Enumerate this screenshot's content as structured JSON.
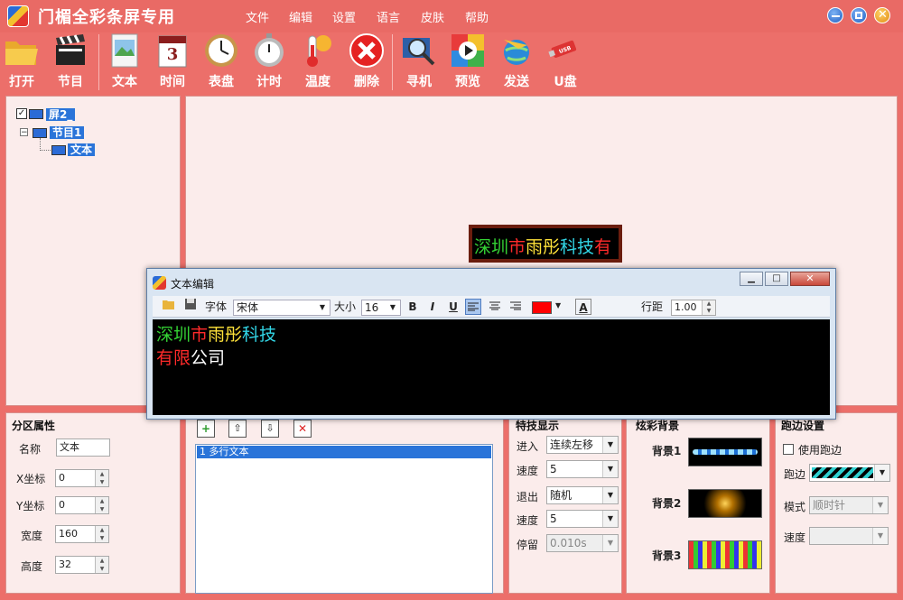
{
  "app": {
    "title": "门楣全彩条屏专用"
  },
  "menu": [
    "文件",
    "编辑",
    "设置",
    "语言",
    "皮肤",
    "帮助"
  ],
  "toolbar": [
    {
      "label": "打开",
      "icon": "folder-open-icon"
    },
    {
      "label": "节目",
      "icon": "clapperboard-icon"
    },
    {
      "label": "文本",
      "icon": "text-document-icon"
    },
    {
      "label": "时间",
      "icon": "calendar-icon"
    },
    {
      "label": "表盘",
      "icon": "clock-icon"
    },
    {
      "label": "计时",
      "icon": "stopwatch-icon"
    },
    {
      "label": "温度",
      "icon": "thermometer-icon"
    },
    {
      "label": "删除",
      "icon": "delete-icon"
    },
    {
      "label": "寻机",
      "icon": "search-monitor-icon"
    },
    {
      "label": "预览",
      "icon": "play-icon"
    },
    {
      "label": "发送",
      "icon": "send-globe-icon"
    },
    {
      "label": "U盘",
      "icon": "usb-drive-icon"
    }
  ],
  "tree": {
    "screen": "屏2_",
    "program": "节目1",
    "item": "文本"
  },
  "preview": {
    "text_segments": [
      {
        "text": "深圳",
        "color": "#34d234"
      },
      {
        "text": "市",
        "color": "#ff2a2a"
      },
      {
        "text": "雨彤",
        "color": "#ffe23a"
      },
      {
        "text": "科技",
        "color": "#32d6e6"
      },
      {
        "text": "有",
        "color": "#ff2a2a"
      }
    ]
  },
  "dialog": {
    "title": "文本编辑",
    "font_label": "字体",
    "font_value": "宋体",
    "size_label": "大小",
    "size_value": "16",
    "bold": "B",
    "italic": "I",
    "underline": "U",
    "color_value": "#ff0000",
    "line_spacing_label": "行距",
    "line_spacing_value": "1.00",
    "line1": [
      {
        "text": "深圳",
        "color": "#34d234"
      },
      {
        "text": "市",
        "color": "#ff2a2a"
      },
      {
        "text": "雨彤",
        "color": "#ffe23a"
      },
      {
        "text": "科技",
        "color": "#32d6e6"
      }
    ],
    "line2": [
      {
        "text": "有限",
        "color": "#ff2a2a"
      },
      {
        "text": "公司",
        "color": "#ffffff"
      }
    ]
  },
  "region": {
    "title": "分区属性",
    "name_label": "名称",
    "name_value": "文本",
    "x_label": "X坐标",
    "x_value": "0",
    "y_label": "Y坐标",
    "y_value": "0",
    "width_label": "宽度",
    "width_value": "160",
    "height_label": "高度",
    "height_value": "32"
  },
  "list": {
    "items": [
      "1 多行文本"
    ]
  },
  "effects": {
    "title": "特技显示",
    "enter_label": "进入",
    "enter_value": "连续左移",
    "speed1_label": "速度",
    "speed1_value": "5",
    "exit_label": "退出",
    "exit_value": "随机",
    "speed2_label": "速度",
    "speed2_value": "5",
    "stay_label": "停留",
    "stay_value": "0.010s"
  },
  "background": {
    "title": "炫彩背景",
    "bg1": "背景1",
    "bg2": "背景2",
    "bg3": "背景3"
  },
  "border": {
    "title": "跑边设置",
    "use_label": "使用跑边",
    "border_label": "跑边",
    "mode_label": "模式",
    "mode_value": "顺时针",
    "speed_label": "速度"
  },
  "colors": {
    "accent": "#ec6f6a",
    "selection": "#2a74d9"
  }
}
